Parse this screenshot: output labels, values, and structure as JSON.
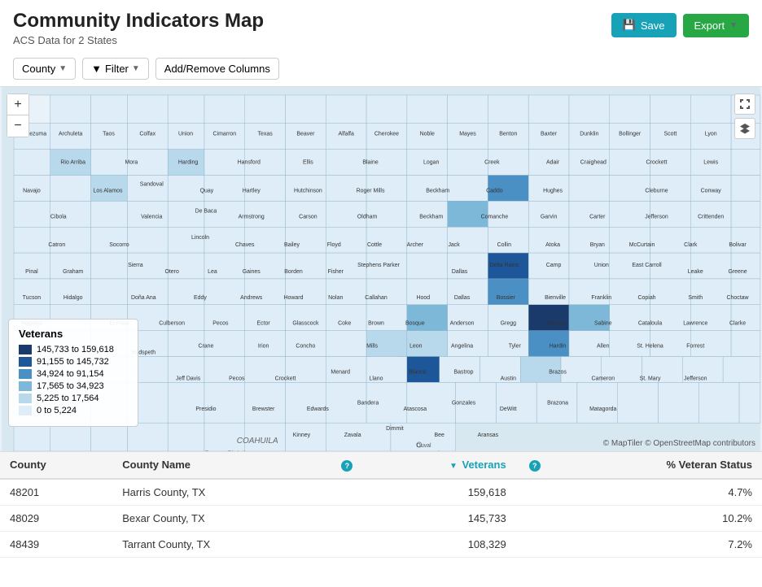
{
  "header": {
    "title": "Community Indicators Map",
    "subtitle": "ACS Data for 2 States",
    "save_label": "Save",
    "export_label": "Export"
  },
  "toolbar": {
    "county_label": "County",
    "filter_label": "Filter",
    "columns_label": "Add/Remove Columns"
  },
  "map": {
    "zoom_in": "+",
    "zoom_out": "−",
    "attribution": "© MapTiler © OpenStreetMap contributors"
  },
  "legend": {
    "title": "Veterans",
    "items": [
      {
        "label": "145,733 to 159,618",
        "color": "#1a3a6b"
      },
      {
        "label": "91,155 to 145,732",
        "color": "#1e5799"
      },
      {
        "label": "34,924 to 91,154",
        "color": "#4a90c4"
      },
      {
        "label": "17,565 to 34,923",
        "color": "#7eb8d9"
      },
      {
        "label": "5,225 to 17,564",
        "color": "#b8d8ec"
      },
      {
        "label": "0 to 5,224",
        "color": "#deedf8"
      }
    ]
  },
  "table": {
    "columns": [
      {
        "key": "county_code",
        "label": "County",
        "sortable": false
      },
      {
        "key": "county_name",
        "label": "County Name",
        "sortable": false
      },
      {
        "key": "info1",
        "label": "?",
        "info": true
      },
      {
        "key": "veterans",
        "label": "Veterans",
        "sortable": true,
        "sorted": true
      },
      {
        "key": "info2",
        "label": "?",
        "info": true
      },
      {
        "key": "veteran_status",
        "label": "% Veteran Status",
        "sortable": false
      }
    ],
    "rows": [
      {
        "county_code": "48201",
        "county_name": "Harris County, TX",
        "veterans": "159,618",
        "veteran_status": "4.7%"
      },
      {
        "county_code": "48029",
        "county_name": "Bexar County, TX",
        "veterans": "145,733",
        "veteran_status": "10.2%"
      },
      {
        "county_code": "48439",
        "county_name": "Tarrant County, TX",
        "veterans": "108,329",
        "veteran_status": "7.2%"
      }
    ]
  }
}
